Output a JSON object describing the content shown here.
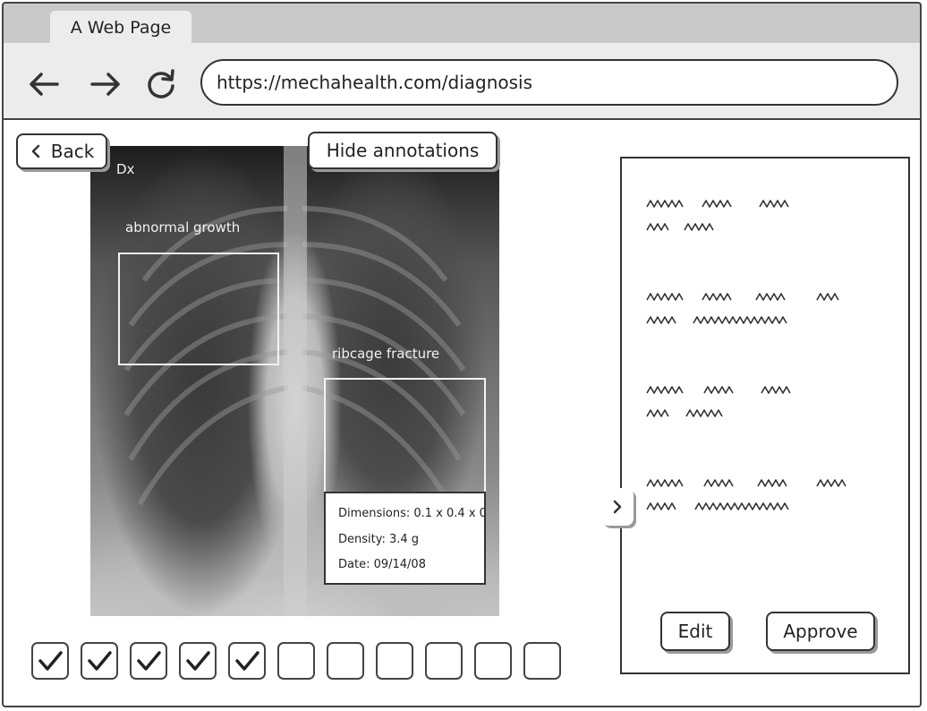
{
  "browser": {
    "tab_title": "A Web Page",
    "url": "https://mechahealth.com/diagnosis"
  },
  "toolbar": {
    "back_icon": "arrow-left-icon",
    "forward_icon": "arrow-right-icon",
    "reload_icon": "reload-icon"
  },
  "viewer": {
    "back_label": "Back",
    "hide_annotations_label": "Hide annotations",
    "image_corner_label": "Dx",
    "annotations": [
      {
        "label": "abnormal growth"
      },
      {
        "label": "ribcage fracture"
      }
    ],
    "details": {
      "dimensions": "Dimensions: 0.1 x 0.4 x 0.",
      "density": "Density: 3.4 g",
      "date": "Date: 09/14/08"
    },
    "checkboxes": [
      true,
      true,
      true,
      true,
      true,
      false,
      false,
      false,
      false,
      false,
      false
    ]
  },
  "panel": {
    "paragraph_count": 4,
    "expand_icon": "chevron-right-icon",
    "edit_label": "Edit",
    "approve_label": "Approve"
  },
  "colors": {
    "stroke": "#333333",
    "chrome": "#ececec",
    "tabbar": "#c9c9c9",
    "annotation": "#f2f2f2"
  }
}
